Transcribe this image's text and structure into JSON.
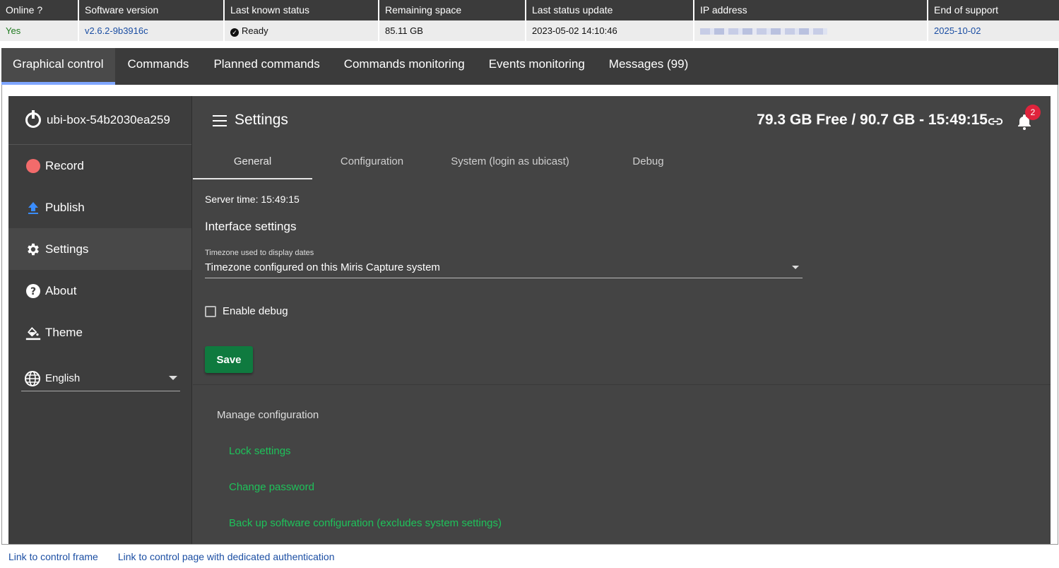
{
  "info_table": {
    "headers": [
      "Online ?",
      "Software version",
      "Last known status",
      "Remaining space",
      "Last status update",
      "IP address",
      "End of support"
    ],
    "values": {
      "online": "Yes",
      "version": "v2.6.2-9b3916c",
      "status": "Ready",
      "remaining_space": "85.11 GB",
      "last_update": "2023-05-02 14:10:46",
      "end_of_support": "2025-10-02"
    },
    "colors": {
      "header_bg": "#3b3b3b",
      "row_bg": "#ececec",
      "online": "#1f7a1f",
      "link": "#1b4ea3"
    }
  },
  "tabs": [
    {
      "label": "Graphical control",
      "active": true
    },
    {
      "label": "Commands"
    },
    {
      "label": "Planned commands"
    },
    {
      "label": "Commands monitoring"
    },
    {
      "label": "Events monitoring"
    },
    {
      "label": "Messages (99)"
    }
  ],
  "sidebar": {
    "device_name": "ubi-box-54b2030ea259",
    "items": [
      {
        "label": "Record",
        "icon": "record-dot-icon"
      },
      {
        "label": "Publish",
        "icon": "upload-icon"
      },
      {
        "label": "Settings",
        "icon": "gear-icon",
        "active": true
      },
      {
        "label": "About",
        "icon": "question-icon"
      },
      {
        "label": "Theme",
        "icon": "paint-bucket-icon"
      }
    ],
    "language": "English"
  },
  "header": {
    "title": "Settings",
    "storage": "79.3 GB Free / 90.7 GB - 15:49:15",
    "notification_count": "2"
  },
  "subtabs": [
    {
      "label": "General",
      "active": true
    },
    {
      "label": "Configuration"
    },
    {
      "label": "System (login as ubicast)"
    },
    {
      "label": "Debug"
    }
  ],
  "general": {
    "server_time": "Server time: 15:49:15",
    "interface_heading": "Interface settings",
    "timezone_label": "Timezone used to display dates",
    "timezone_value": "Timezone configured on this Miris Capture system",
    "debug_label": "Enable debug",
    "debug_checked": false,
    "save_label": "Save"
  },
  "manage": {
    "heading": "Manage configuration",
    "links": [
      "Lock settings",
      "Change password",
      "Back up software configuration (excludes system settings)"
    ]
  },
  "bottom_links": [
    "Link to control frame",
    "Link to control page with dedicated authentication"
  ],
  "colors": {
    "app_bg": "#444444",
    "sidebar_bg": "#3d3d3d",
    "accent_green": "#1ec25a",
    "save_green": "#0f7a3f",
    "badge_red": "#e0233c",
    "tab_underline": "#7fa6ff"
  }
}
